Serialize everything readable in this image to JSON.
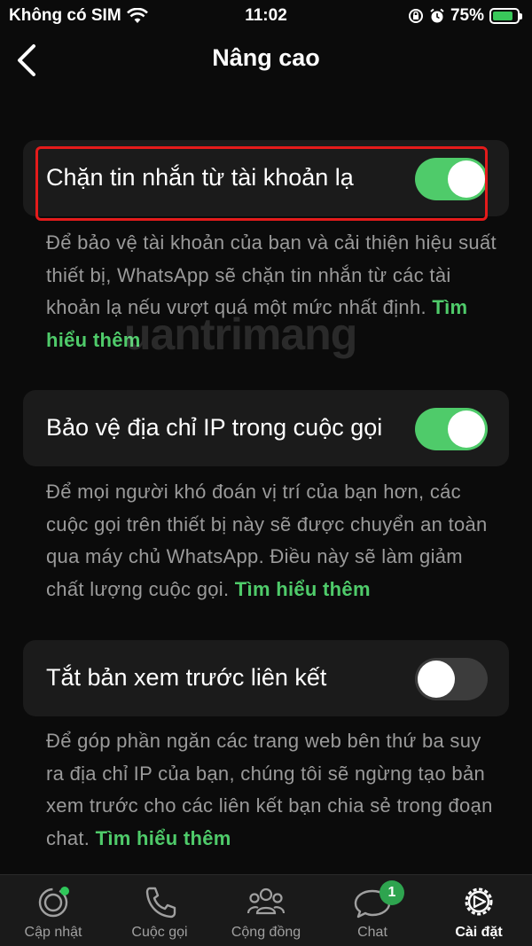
{
  "status_bar": {
    "carrier": "Không có SIM",
    "time": "11:02",
    "battery": "75%"
  },
  "header": {
    "title": "Nâng cao"
  },
  "settings": [
    {
      "label": "Chặn tin nhắn từ tài khoản lạ",
      "enabled": true,
      "description": "Để bảo vệ tài khoản của bạn và cải thiện hiệu suất thiết bị, WhatsApp sẽ chặn tin nhắn từ các tài khoản lạ nếu vượt quá một mức nhất định.",
      "link": "Tìm hiểu thêm"
    },
    {
      "label": "Bảo vệ địa chỉ IP trong cuộc gọi",
      "enabled": true,
      "description": "Để mọi người khó đoán vị trí của bạn hơn, các cuộc gọi trên thiết bị này sẽ được chuyển an toàn qua máy chủ WhatsApp. Điều này sẽ làm giảm chất lượng cuộc gọi.",
      "link": "Tìm hiểu thêm"
    },
    {
      "label": "Tắt bản xem trước liên kết",
      "enabled": false,
      "description": "Để góp phần ngăn các trang web bên thứ ba suy ra địa chỉ IP của bạn, chúng tôi sẽ ngừng tạo bản xem trước cho các liên kết bạn chia sẻ trong đoạn chat.",
      "link": "Tìm hiểu thêm"
    }
  ],
  "watermark": "uantrimang",
  "tabs": [
    {
      "label": "Cập nhật",
      "icon": "updates-icon"
    },
    {
      "label": "Cuộc gọi",
      "icon": "phone-icon"
    },
    {
      "label": "Cộng đồng",
      "icon": "community-icon"
    },
    {
      "label": "Chat",
      "icon": "chat-icon",
      "badge": "1"
    },
    {
      "label": "Cài đặt",
      "icon": "settings-gear-icon",
      "active": true
    }
  ],
  "colors": {
    "accent": "#4fcb6a",
    "highlight": "#e41b1b",
    "background": "#0b0b0b",
    "card": "#1b1b1b"
  }
}
